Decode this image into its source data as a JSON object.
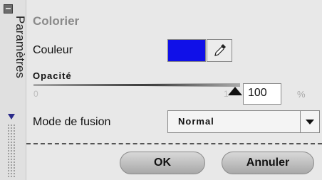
{
  "sidebar": {
    "tab_label": "Paramètres"
  },
  "panel": {
    "title": "Colorier",
    "color": {
      "label": "Couleur",
      "value": "#1010e8"
    },
    "opacity": {
      "label": "Opacité",
      "min": "0",
      "max": "1",
      "value": "100",
      "unit": "%",
      "fraction": 1.0
    },
    "blend_mode": {
      "label": "Mode de fusion",
      "selected": "Normal"
    },
    "buttons": {
      "ok": "OK",
      "cancel": "Annuler"
    }
  },
  "colors": {
    "swatch": "#1010e8",
    "background": "#e8e8e8",
    "title": "#8a8a8a"
  },
  "icons": {
    "eyedropper": "eyedropper-icon",
    "dropdown": "chevron-down-icon",
    "collapse": "collapse-icon"
  }
}
